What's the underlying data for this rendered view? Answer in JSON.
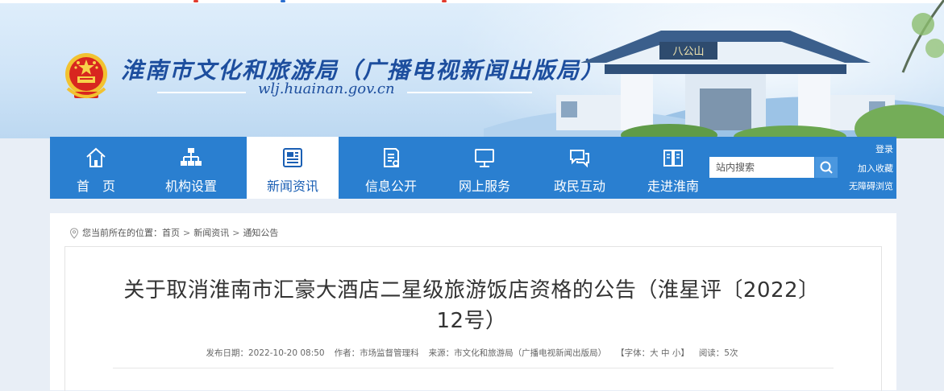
{
  "header": {
    "site_title": "淮南市文化和旅游局（广播电视新闻出版局）",
    "site_url": "wlj.huainan.gov.cn",
    "gate_sign": "八公山",
    "colors": {
      "primary": "#2a7fd0",
      "title": "#1d4e9e"
    }
  },
  "nav": {
    "items": [
      {
        "label": "首　页",
        "icon": "home-icon"
      },
      {
        "label": "机构设置",
        "icon": "org-chart-icon"
      },
      {
        "label": "新闻资讯",
        "icon": "newspaper-icon",
        "active": true
      },
      {
        "label": "信息公开",
        "icon": "document-icon"
      },
      {
        "label": "网上服务",
        "icon": "monitor-icon"
      },
      {
        "label": "政民互动",
        "icon": "chat-icon"
      },
      {
        "label": "走进淮南",
        "icon": "book-icon"
      }
    ],
    "search_placeholder": "站内搜索",
    "util_links": {
      "login": "登录",
      "favorite": "加入收藏",
      "accessible": "无障碍浏览"
    }
  },
  "breadcrumb": {
    "prefix": "您当前所在的位置：",
    "items": [
      "首页",
      "新闻资讯",
      "通知公告"
    ],
    "separator": ">"
  },
  "article": {
    "title": "关于取消淮南市汇豪大酒店二星级旅游饭店资格的公告（淮星评〔2022〕12号）",
    "meta": {
      "date": "发布日期：2022-10-20 08:50",
      "author": "作者：市场监督管理科",
      "source": "来源：市文化和旅游局（广播电视新闻出版局）",
      "font_prefix": "【字体：",
      "font_large": "大",
      "font_medium": "中",
      "font_small": "小",
      "font_suffix": "】",
      "reads": "阅读：5次"
    }
  }
}
